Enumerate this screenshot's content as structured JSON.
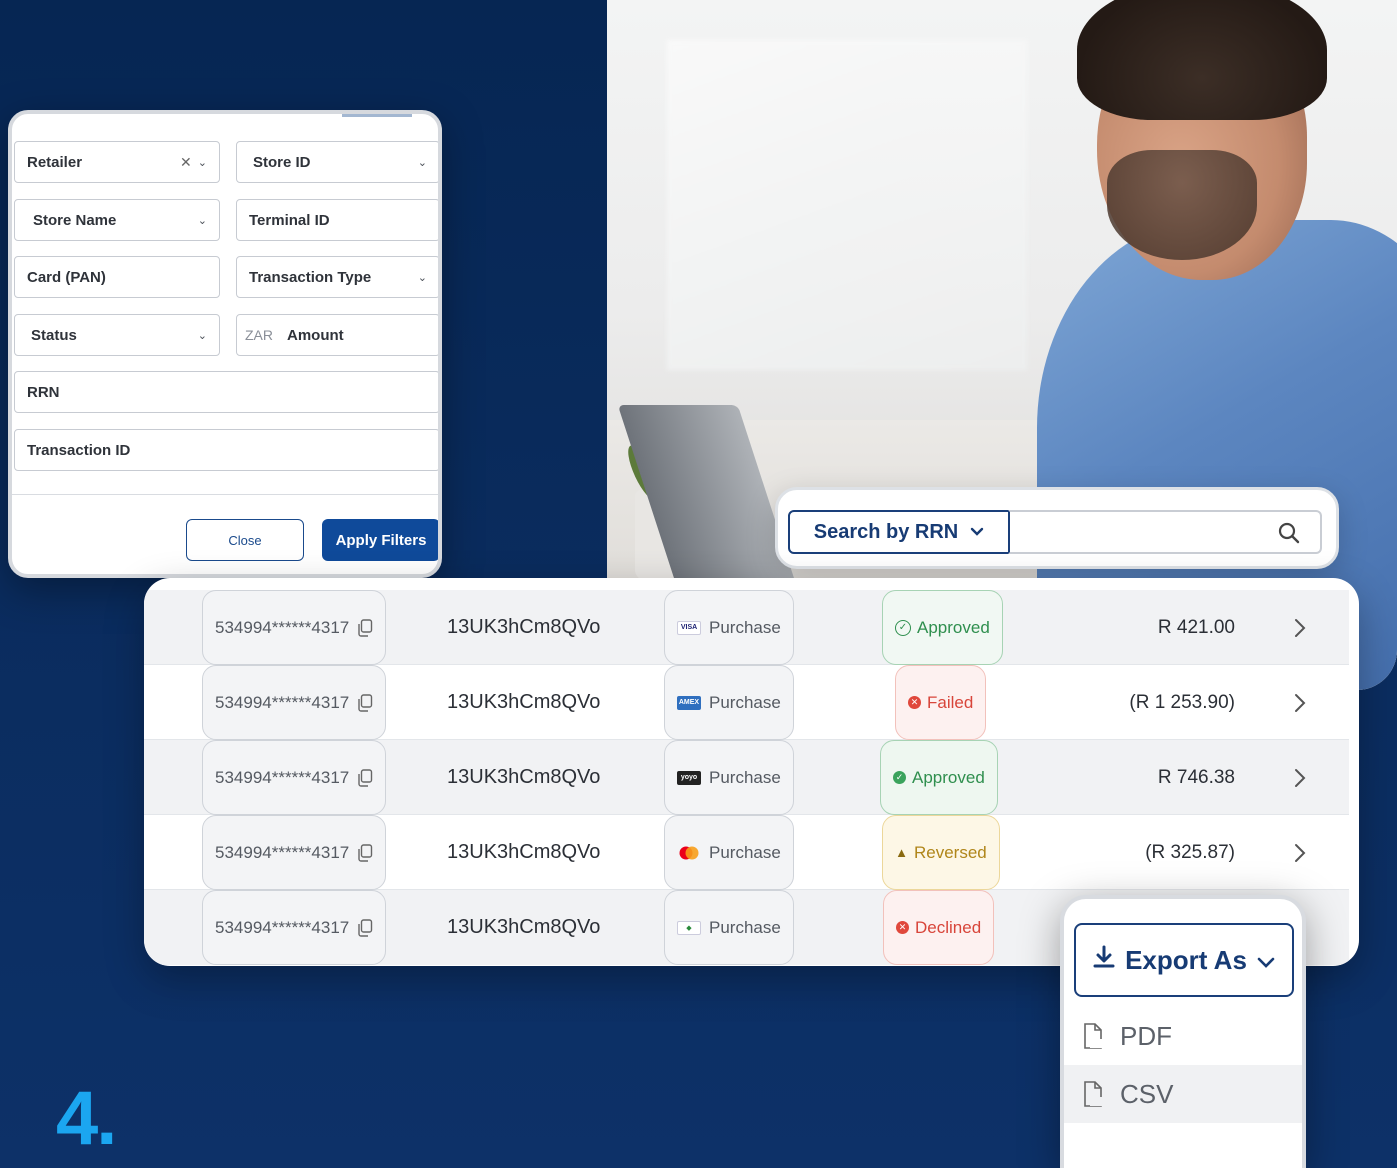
{
  "filters": {
    "retailer": "Retailer",
    "store_id": "Store ID",
    "store_name": "Store Name",
    "terminal_id": "Terminal ID",
    "card_pan": "Card (PAN)",
    "transaction_type": "Transaction Type",
    "status": "Status",
    "amount_currency": "ZAR",
    "amount": "Amount",
    "rrn": "RRN",
    "transaction_id": "Transaction ID",
    "close_label": "Close",
    "apply_label": "Apply Filters"
  },
  "search": {
    "type_label": "Search by RRN",
    "value": ""
  },
  "transactions": [
    {
      "pan": "534994******4317",
      "rrn": "13UK3hCm8QVo",
      "card_brand": "visa",
      "type": "Purchase",
      "status": "Approved",
      "status_style": "approved-outline",
      "amount": "R 421.00"
    },
    {
      "pan": "534994******4317",
      "rrn": "13UK3hCm8QVo",
      "card_brand": "amex",
      "type": "Purchase",
      "status": "Failed",
      "status_style": "failed",
      "amount": "(R 1 253.90)"
    },
    {
      "pan": "534994******4317",
      "rrn": "13UK3hCm8QVo",
      "card_brand": "yoyo",
      "type": "Purchase",
      "status": "Approved",
      "status_style": "approved",
      "amount": "R 746.38"
    },
    {
      "pan": "534994******4317",
      "rrn": "13UK3hCm8QVo",
      "card_brand": "mastercard",
      "type": "Purchase",
      "status": "Reversed",
      "status_style": "reversed",
      "amount": "(R 325.87)"
    },
    {
      "pan": "534994******4317",
      "rrn": "13UK3hCm8QVo",
      "card_brand": "other",
      "type": "Purchase",
      "status": "Declined",
      "status_style": "declined",
      "amount": ""
    }
  ],
  "export": {
    "label": "Export As",
    "options": [
      "PDF",
      "CSV"
    ]
  },
  "step_number": "4.",
  "colors": {
    "background": "#062653",
    "accent": "#0f4a9a",
    "step": "#1ba6f0",
    "approved": "#3aa35c",
    "failed": "#e0483c",
    "reversed": "#c99a1c"
  }
}
